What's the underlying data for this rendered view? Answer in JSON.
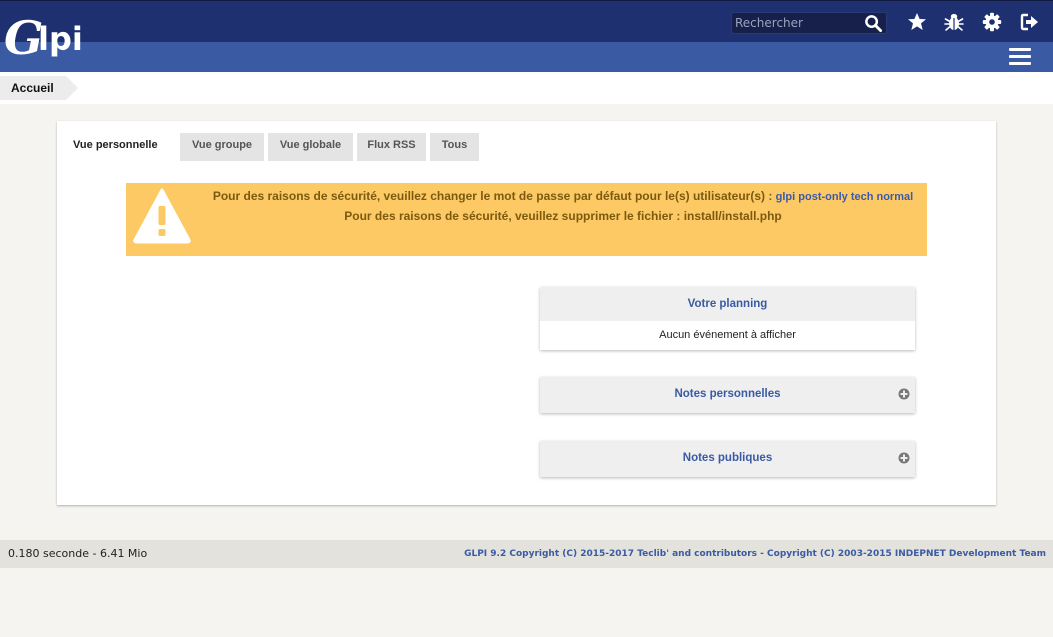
{
  "header": {
    "logo_text": "Glpi",
    "search": {
      "placeholder": "Rechercher",
      "value": ""
    },
    "icons": [
      "star-icon",
      "bug-icon",
      "gear-icon",
      "logout-icon"
    ],
    "menu_icon": "hamburger-icon"
  },
  "breadcrumb": {
    "label": "Accueil"
  },
  "tabs": [
    {
      "label": "Vue personnelle",
      "active": true
    },
    {
      "label": "Vue groupe",
      "active": false
    },
    {
      "label": "Vue globale",
      "active": false
    },
    {
      "label": "Flux RSS",
      "active": false
    },
    {
      "label": "Tous",
      "active": false
    }
  ],
  "alert": {
    "line1_text": "Pour des raisons de sécurité, veuillez changer le mot de passe par défaut pour le(s) utilisateur(s) : ",
    "line1_users": "glpi post-only tech normal",
    "line2_text": "Pour des raisons de sécurité, veuillez supprimer le fichier : install/install.php",
    "icon": "warning-icon"
  },
  "panels": {
    "planning": {
      "title": "Votre planning",
      "body": "Aucun événement à afficher"
    },
    "personal_notes": {
      "title": "Notes personnelles"
    },
    "public_notes": {
      "title": "Notes publiques"
    }
  },
  "footer": {
    "timing": "0.180 seconde - 6.41 Mio",
    "copyright": "GLPI 9.2 Copyright (C) 2015-2017 Teclib' and contributors - Copyright (C) 2003-2015 INDEPNET Development Team"
  },
  "colors": {
    "header_dark": "#1e3070",
    "header_light": "#3a5aa3",
    "alert_bg": "#fdc964",
    "link_blue": "#3a5aa3"
  }
}
